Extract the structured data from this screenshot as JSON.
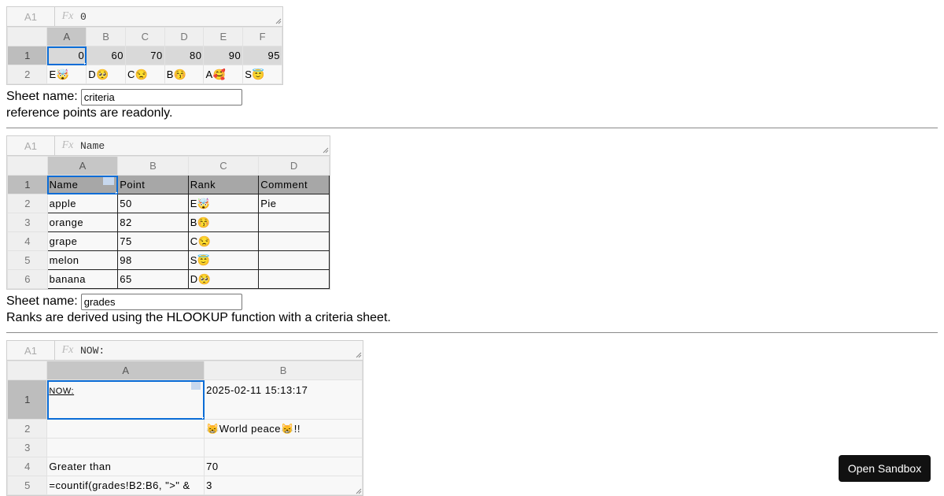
{
  "sheet1": {
    "address": "A1",
    "fx": "Fx",
    "formula": "0",
    "columns": [
      "A",
      "B",
      "C",
      "D",
      "E",
      "F"
    ],
    "rows": [
      {
        "num": "1",
        "cells": [
          "0",
          "60",
          "70",
          "80",
          "90",
          "95"
        ]
      },
      {
        "num": "2",
        "cells": [
          "E🤯",
          "D🥺",
          "C😒",
          "B😚",
          "A🥰",
          "S😇"
        ]
      }
    ],
    "name_label": "Sheet name:",
    "name_value": "criteria",
    "note": "reference points are readonly."
  },
  "sheet2": {
    "address": "A1",
    "fx": "Fx",
    "formula": "Name",
    "columns": [
      "A",
      "B",
      "C",
      "D"
    ],
    "header": [
      "Name",
      "Point",
      "Rank",
      "Comment"
    ],
    "rows": [
      {
        "num": "2",
        "cells": [
          "apple",
          "50",
          "E🤯",
          "Pie"
        ]
      },
      {
        "num": "3",
        "cells": [
          "orange",
          "82",
          "B😚",
          ""
        ]
      },
      {
        "num": "4",
        "cells": [
          "grape",
          "75",
          "C😒",
          ""
        ]
      },
      {
        "num": "5",
        "cells": [
          "melon",
          "98",
          "S😇",
          ""
        ]
      },
      {
        "num": "6",
        "cells": [
          "banana",
          "65",
          "D🥺",
          ""
        ]
      }
    ],
    "name_label": "Sheet name:",
    "name_value": "grades",
    "note": "Ranks are derived using the HLOOKUP function with a criteria sheet."
  },
  "sheet3": {
    "address": "A1",
    "fx": "Fx",
    "formula": "NOW:",
    "columns": [
      "A",
      "B"
    ],
    "rows": [
      {
        "num": "1",
        "cells": [
          "NOW:",
          "2025-02-11 15:13:17"
        ]
      },
      {
        "num": "2",
        "cells": [
          "",
          "😸World peace😸!!"
        ]
      },
      {
        "num": "3",
        "cells": [
          "",
          ""
        ]
      },
      {
        "num": "4",
        "cells": [
          "Greater than",
          "70"
        ]
      },
      {
        "num": "5",
        "cells": [
          "=countif(grades!B2:B6, \">\" & ",
          "3"
        ]
      }
    ]
  },
  "sandbox_button": "Open Sandbox",
  "colors": {
    "selection": "#0a6cd6",
    "header_bg": "#efefef",
    "selected_header_bg": "#bdbdbd"
  }
}
